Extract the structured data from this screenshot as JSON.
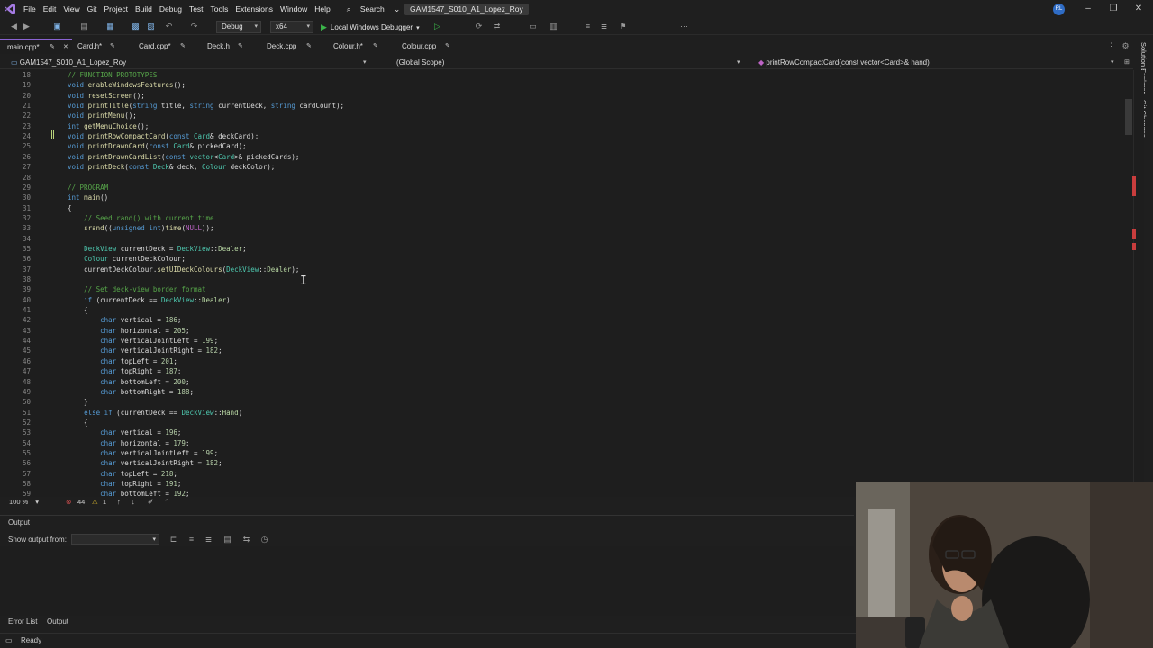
{
  "menu": [
    "File",
    "Edit",
    "View",
    "Git",
    "Project",
    "Build",
    "Debug",
    "Test",
    "Tools",
    "Extensions",
    "Window",
    "Help"
  ],
  "search_label": "Search",
  "solution_title": "GAM1547_S010_A1_Lopez_Roy",
  "user_initials": "RL",
  "toolbar": {
    "config": "Debug",
    "platform": "x64",
    "run_label": "Local Windows Debugger"
  },
  "tabs": [
    {
      "label": "main.cpp*",
      "active": true
    },
    {
      "label": "Card.h*"
    },
    {
      "label": "Card.cpp*"
    },
    {
      "label": "Deck.h"
    },
    {
      "label": "Deck.cpp"
    },
    {
      "label": "Colour.h*"
    },
    {
      "label": "Colour.cpp"
    }
  ],
  "navbar": {
    "project": "GAM1547_S010_A1_Lopez_Roy",
    "scope": "(Global Scope)",
    "member": "printRowCompactCard(const vector<Card>& hand)"
  },
  "editor": {
    "first_line": 18,
    "lines": [
      "// FUNCTION PROTOTYPES",
      "void enableWindowsFeatures();",
      "void resetScreen();",
      "void printTitle(string title, string currentDeck, string cardCount);",
      "void printMenu();",
      "int getMenuChoice();",
      "void printRowCompactCard(const Card& deckCard);",
      "void printDrawnCard(const Card& pickedCard);",
      "void printDrawnCardList(const vector<Card>& pickedCards);",
      "void printDeck(const Deck& deck, Colour deckColor);",
      "",
      "// PROGRAM",
      "int main()",
      "{",
      "    // Seed rand() with current time",
      "    srand((unsigned int)time(NULL));",
      "",
      "    DeckView currentDeck = DeckView::Dealer;",
      "    Colour currentDeckColour;",
      "    currentDeckColour.setUIDeckColours(DeckView::Dealer);",
      "",
      "    // Set deck-view border format",
      "    if (currentDeck == DeckView::Dealer)",
      "    {",
      "        char vertical = 186;",
      "        char horizontal = 205;",
      "        char verticalJointLeft = 199;",
      "        char verticalJointRight = 182;",
      "        char topLeft = 201;",
      "        char topRight = 187;",
      "        char bottomLeft = 200;",
      "        char bottomRight = 188;",
      "    }",
      "    else if (currentDeck == DeckView::Hand)",
      "    {",
      "        char vertical = 196;",
      "        char horizontal = 179;",
      "        char verticalJointLeft = 199;",
      "        char verticalJointRight = 182;",
      "        char topLeft = 218;",
      "        char topRight = 191;",
      "        char bottomLeft = 192;"
    ]
  },
  "editor_status": {
    "zoom": "100 %",
    "errors": "44",
    "warnings": "1"
  },
  "output": {
    "title": "Output",
    "show_from_label": "Show output from:"
  },
  "bottom_tabs": [
    "Error List",
    "Output"
  ],
  "status": "Ready",
  "side_rail": [
    "Solution Explorer",
    "Git Changes"
  ]
}
